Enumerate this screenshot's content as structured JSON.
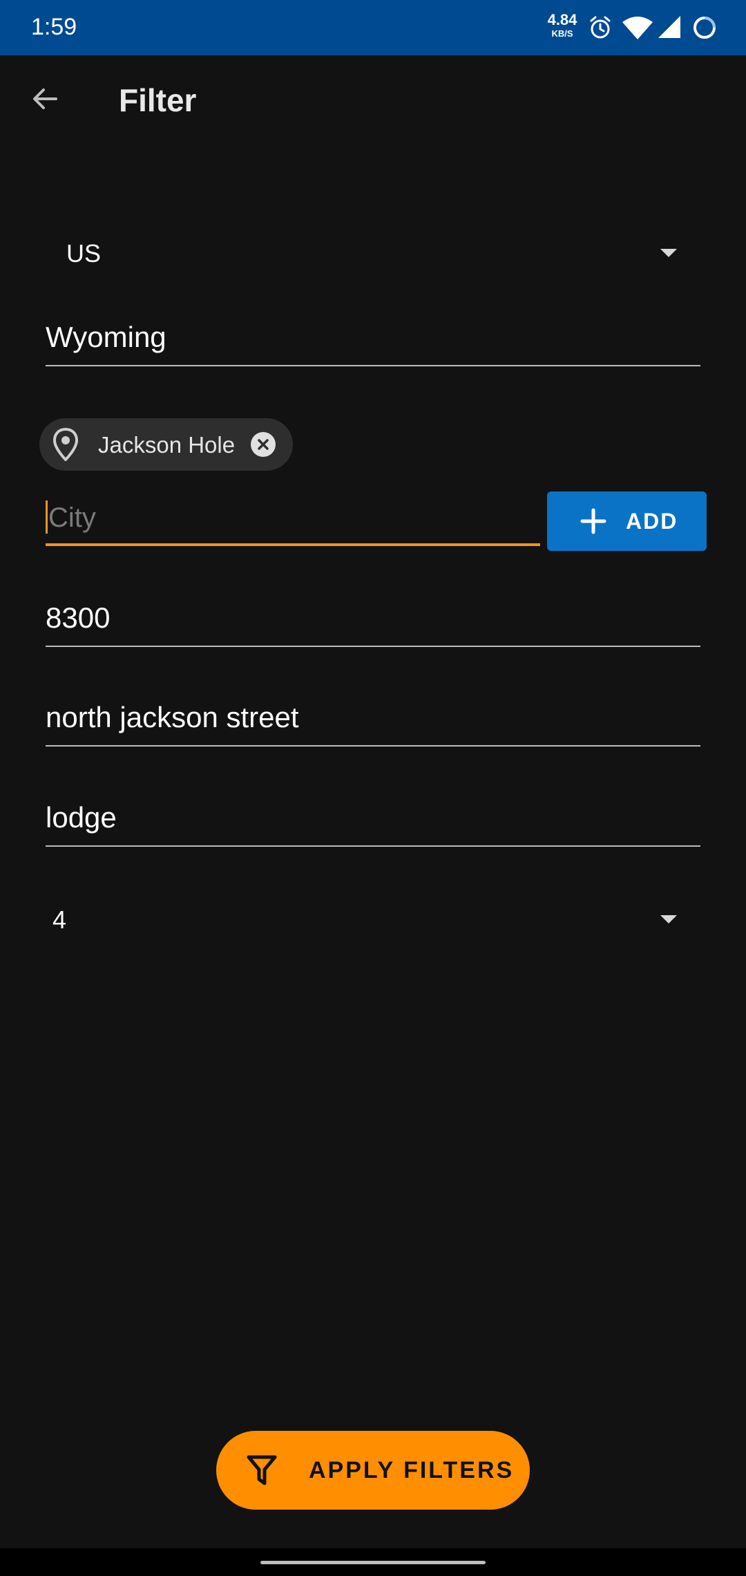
{
  "status_bar": {
    "time": "1:59",
    "network_speed_value": "4.84",
    "network_speed_unit": "KB/S",
    "icons": [
      "alarm-icon",
      "wifi-icon",
      "signal-icon",
      "loading-ring-icon"
    ]
  },
  "header": {
    "title": "Filter",
    "back_icon": "arrow-left-icon"
  },
  "form": {
    "country": {
      "selected": "US"
    },
    "state": {
      "value": "Wyoming"
    },
    "city_chips": [
      {
        "label": "Jackson Hole",
        "icon": "location-pin-icon",
        "remove_icon": "close-circle-icon"
      }
    ],
    "city": {
      "value": "",
      "placeholder": "City"
    },
    "add_button": {
      "label": "ADD",
      "icon": "plus-icon"
    },
    "zip": {
      "value": "8300"
    },
    "street": {
      "value": "north jackson street"
    },
    "keyword": {
      "value": "lodge"
    },
    "count": {
      "selected": "4"
    }
  },
  "apply_button": {
    "label": "APPLY FILTERS",
    "icon": "filter-icon"
  },
  "colors": {
    "status_bar": "#004a91",
    "background": "#121212",
    "accent_orange": "#ff8f00",
    "focus_underline": "#f2931c",
    "add_button": "#0b73c6",
    "chip": "#2e2e2e"
  }
}
